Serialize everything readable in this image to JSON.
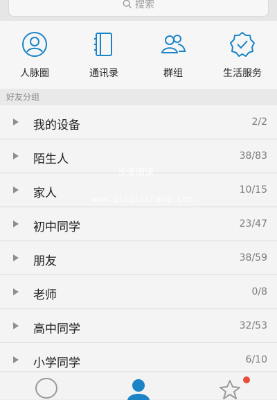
{
  "search": {
    "label": "搜索"
  },
  "shortcuts": [
    {
      "label": "人脉圈",
      "icon": "contact-circle-icon"
    },
    {
      "label": "通讯录",
      "icon": "address-book-icon"
    },
    {
      "label": "群组",
      "icon": "group-icon"
    },
    {
      "label": "生活服务",
      "icon": "badge-check-icon"
    }
  ],
  "section_title": "好友分组",
  "groups": [
    {
      "name": "我的设备",
      "count": "2/2"
    },
    {
      "name": "陌生人",
      "count": "38/83"
    },
    {
      "name": "家人",
      "count": "10/15"
    },
    {
      "name": "初中同学",
      "count": "23/47"
    },
    {
      "name": "朋友",
      "count": "38/59"
    },
    {
      "name": "老师",
      "count": "0/8"
    },
    {
      "name": "高中同学",
      "count": "32/53"
    },
    {
      "name": "小学同学",
      "count": "6/10"
    }
  ],
  "watermark": {
    "line1": "步骤阅读",
    "line2": "www.qinpinchang.com"
  },
  "tabs": [
    {
      "icon": "chat-bubble-icon"
    },
    {
      "icon": "contacts-person-icon"
    },
    {
      "icon": "star-icon"
    }
  ],
  "colors": {
    "accent": "#1a84c6",
    "badge": "#e74c3c"
  }
}
